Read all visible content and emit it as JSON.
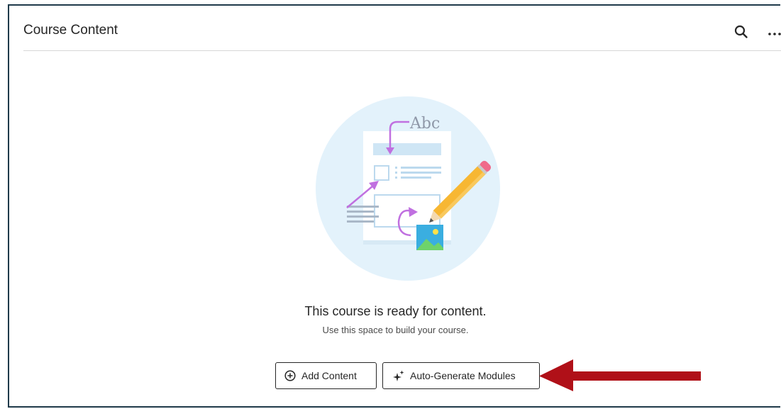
{
  "header": {
    "title": "Course Content"
  },
  "icons": {
    "search": "search-icon",
    "more": "more-options-icon",
    "add": "plus-circle-icon",
    "auto_generate": "sparkle-icon"
  },
  "illustration": {
    "label_text": "Abc"
  },
  "empty_state": {
    "title": "This course is ready for content.",
    "subtitle": "Use this space to build your course."
  },
  "actions": {
    "add_content": "Add Content",
    "auto_generate": "Auto-Generate Modules"
  },
  "colors": {
    "frame_border": "#1f3a4a",
    "annotation_arrow": "#b01018",
    "illustration_bg": "#e3f2fb",
    "accent_purple": "#c070e0",
    "pencil_yellow": "#f7b733"
  }
}
